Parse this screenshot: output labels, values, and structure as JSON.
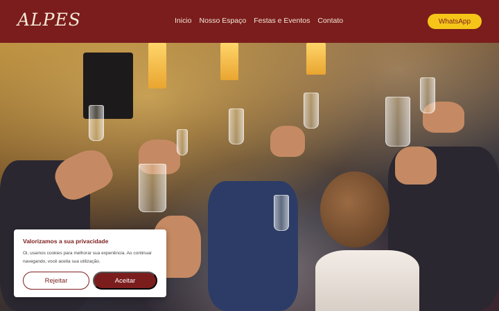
{
  "header": {
    "logo": "ALPES",
    "nav": [
      "Inicio",
      "Nosso Espaço",
      "Festas e Eventos",
      "Contato"
    ],
    "cta": "WhatsApp"
  },
  "hero": {
    "image": "celebration-toast-photo"
  },
  "cookie_banner": {
    "title": "Valorizamos a sua privacidade",
    "text": "Oi, usamos cookies para melhorar sua experiência. Ao continuar navegando, você aceita sua utilização.",
    "reject_label": "Rejeitar",
    "accept_label": "Aceitar"
  },
  "colors": {
    "brand": "#7b1d1d",
    "accent": "#f5c518"
  }
}
